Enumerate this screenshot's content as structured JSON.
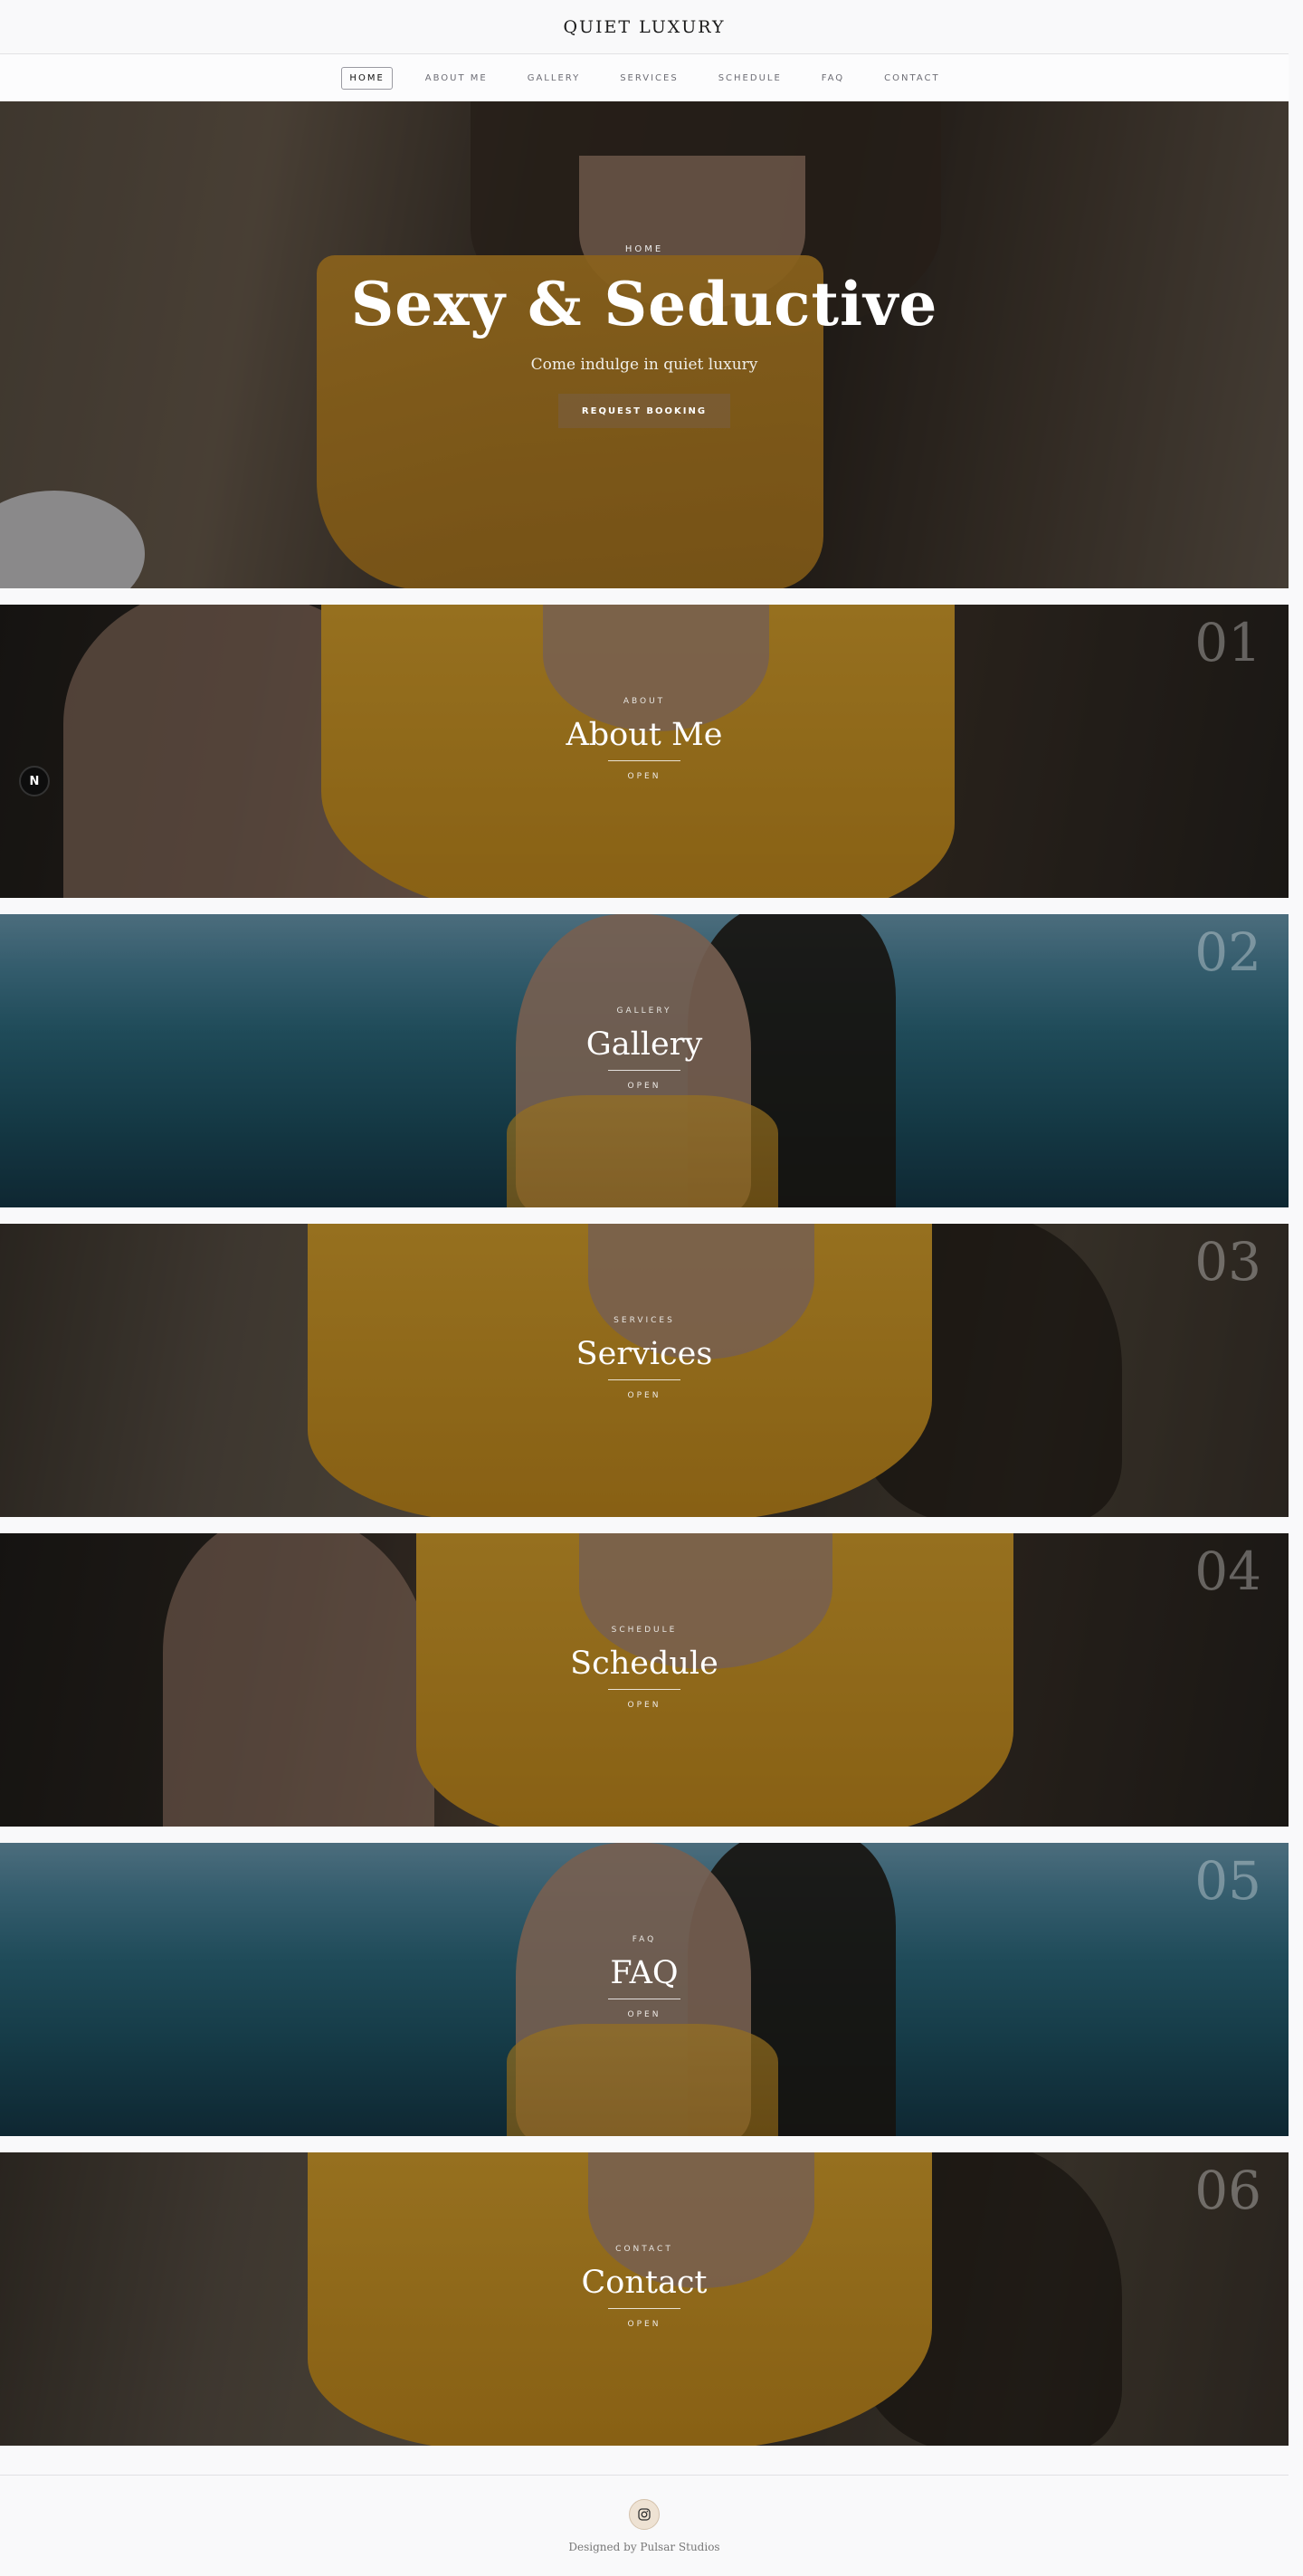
{
  "header": {
    "brand": "QUIET LUXURY"
  },
  "nav": {
    "items": [
      "HOME",
      "ABOUT ME",
      "GALLERY",
      "SERVICES",
      "SCHEDULE",
      "FAQ",
      "CONTACT"
    ],
    "active": "HOME"
  },
  "hero": {
    "eyebrow": "HOME",
    "title": "Sexy & Seductive",
    "subtitle": "Come indulge in quiet luxury",
    "button": "REQUEST BOOKING"
  },
  "panels": [
    {
      "number": "01",
      "eyebrow": "ABOUT",
      "title": "About Me",
      "action": "OPEN"
    },
    {
      "number": "02",
      "eyebrow": "GALLERY",
      "title": "Gallery",
      "action": "OPEN"
    },
    {
      "number": "03",
      "eyebrow": "SERVICES",
      "title": "Services",
      "action": "OPEN"
    },
    {
      "number": "04",
      "eyebrow": "SCHEDULE",
      "title": "Schedule",
      "action": "OPEN"
    },
    {
      "number": "05",
      "eyebrow": "FAQ",
      "title": "FAQ",
      "action": "OPEN"
    },
    {
      "number": "06",
      "eyebrow": "CONTACT",
      "title": "Contact",
      "action": "OPEN"
    }
  ],
  "badge": {
    "label": "N"
  },
  "footer": {
    "credit": "Designed by Pulsar Studios"
  },
  "icons": {
    "social": "instagram-icon"
  }
}
